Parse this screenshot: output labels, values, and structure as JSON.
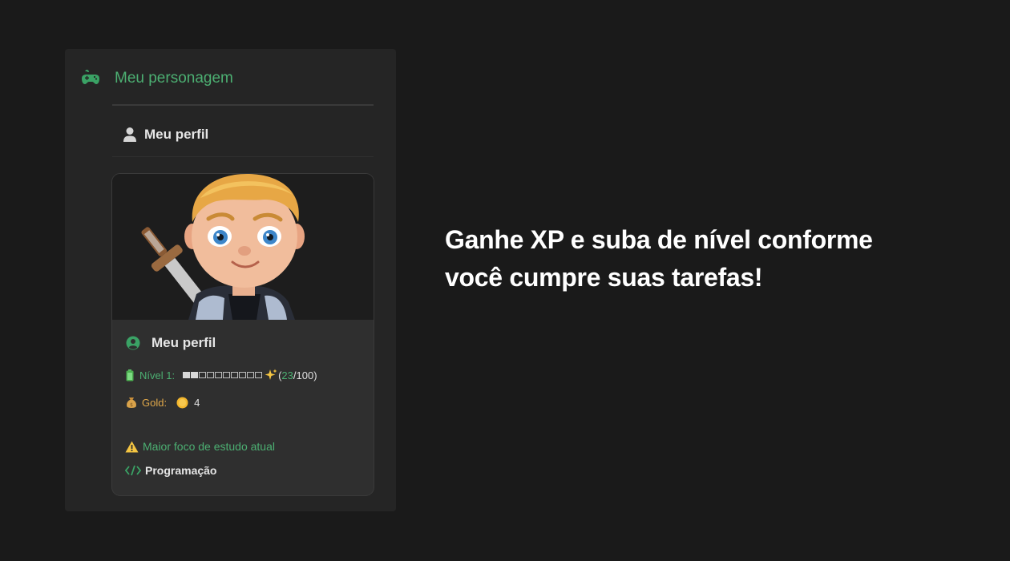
{
  "panel": {
    "title": "Meu personagem",
    "profile_link": "Meu perfil"
  },
  "card": {
    "profile_label": "Meu perfil",
    "level_label": "Nível 1:",
    "xp_current": "23",
    "xp_total": "/100)",
    "xp_open": "(",
    "xp_progress": 0.23,
    "gold_label": "Gold:",
    "gold_value": "4",
    "focus_label": "Maior foco de estudo atual",
    "focus_value": "Programação"
  },
  "headline": "Ganhe XP e suba de nível conforme você cumpre suas tarefas!",
  "colors": {
    "accent": "#4caf72",
    "gold": "#e0a84a",
    "background": "#1a1a1a",
    "panel": "#252525"
  },
  "icons": [
    "gamepad-icon",
    "user-icon",
    "avatar-icon",
    "battery-icon",
    "sparkle-icon",
    "moneybag-icon",
    "coin-icon",
    "warning-icon",
    "code-icon"
  ]
}
